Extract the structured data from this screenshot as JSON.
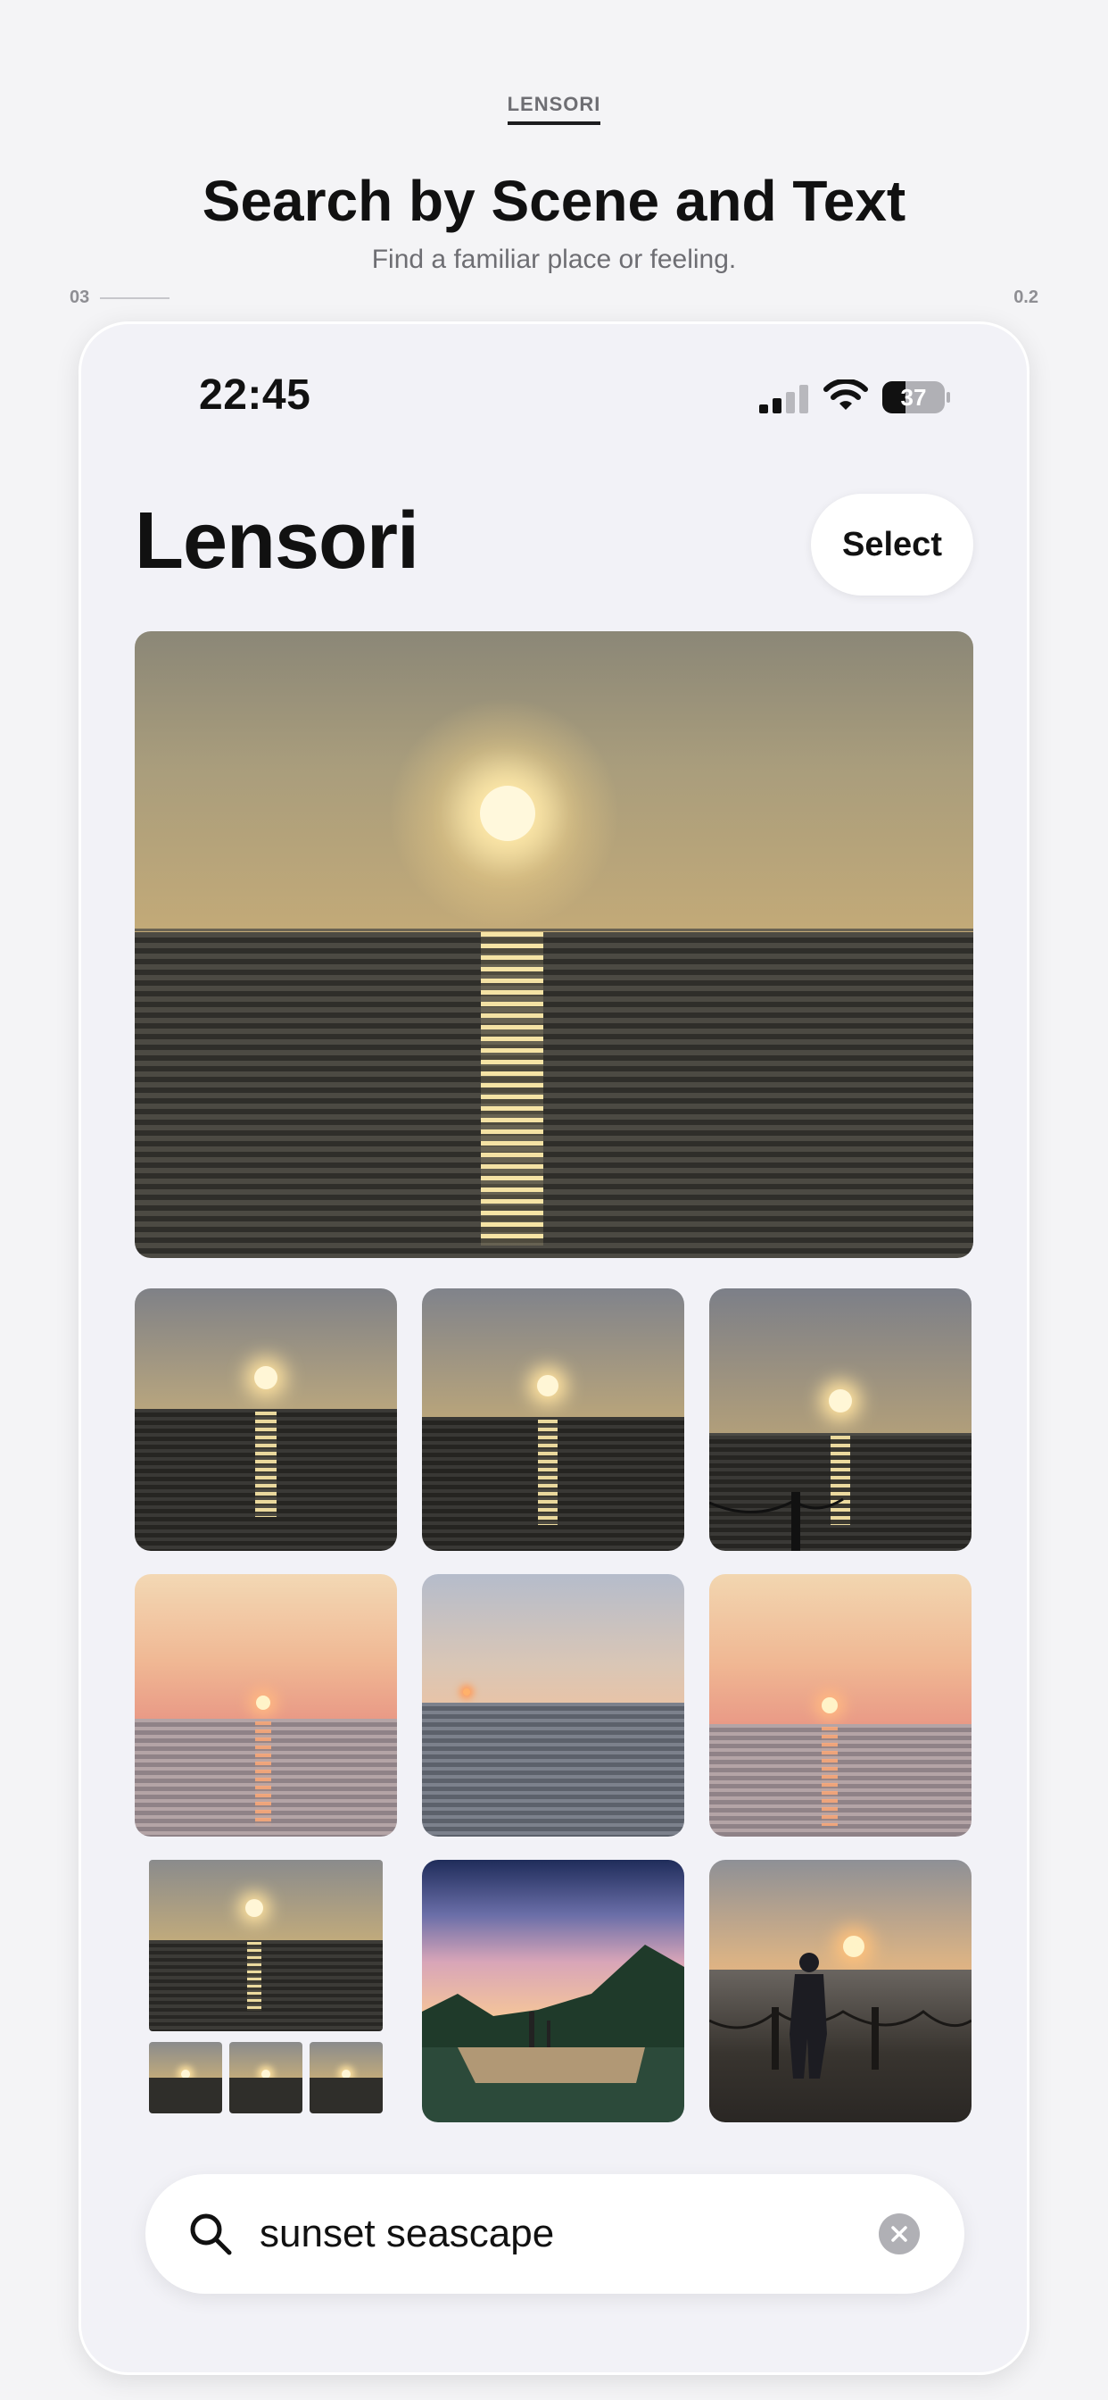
{
  "header": {
    "brand": "LENSORI",
    "title": "Search by Scene and Text",
    "subtitle": "Find a familiar place or feeling.",
    "step": "03",
    "version": "0.2"
  },
  "statusbar": {
    "time": "22:45",
    "battery": "37"
  },
  "app": {
    "title": "Lensori",
    "select_label": "Select"
  },
  "search": {
    "query": "sunset seascape",
    "placeholder": ""
  },
  "photos": {
    "hero": "sunset-sea-photo",
    "grid": [
      "sunset-sea-photo",
      "sunset-sea-photo",
      "sunset-sea-pier-photo",
      "pink-sunset-sea-photo",
      "dusk-sea-photo",
      "pink-sunset-sea-photo",
      "sunset-sea-burst-stack",
      "lake-reflection-photo",
      "person-photographing-sunset-photo"
    ]
  },
  "colors": {
    "accent": "#111111",
    "background": "#f2f2f7",
    "clear_button": "#b0b0b5"
  }
}
